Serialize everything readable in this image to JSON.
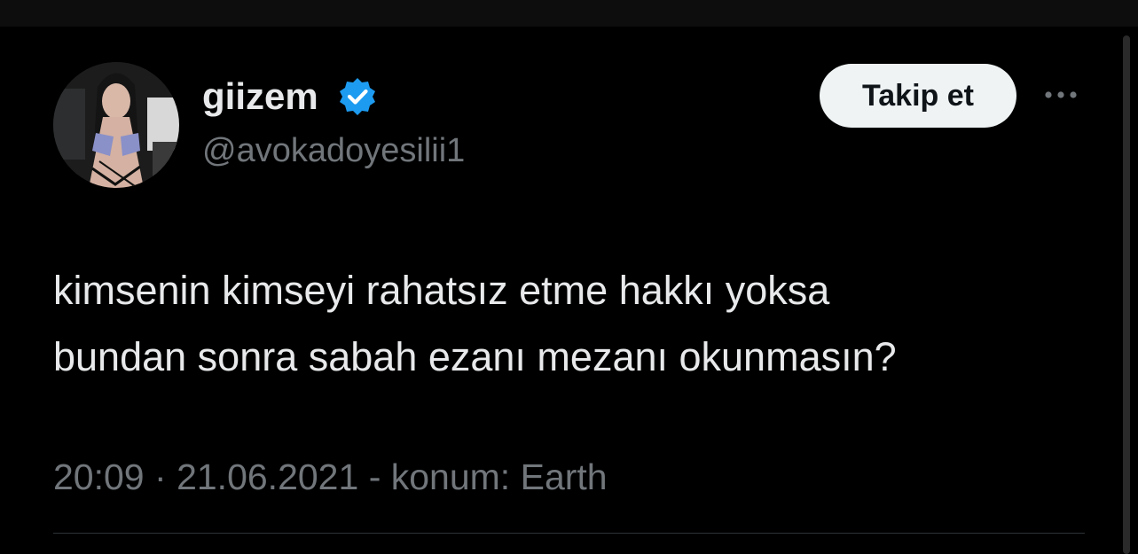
{
  "colors": {
    "background": "#000000",
    "primary_text": "#e7e9ea",
    "secondary_text": "#71767b",
    "verified_badge": "#1d9bf0",
    "follow_button_bg": "#eff3f4",
    "divider": "#2f3336"
  },
  "author": {
    "display_name": "giizem",
    "handle": "@avokadoyesilii1",
    "verified": true,
    "verified_icon": "verified-badge-icon",
    "avatar_icon": "profile-avatar"
  },
  "actions": {
    "follow_label": "Takip et",
    "more_icon": "more-options-icon"
  },
  "tweet": {
    "lines": [
      "kimsenin kimseyi rahatsız etme hakkı yoksa",
      "bundan sonra sabah ezanı mezanı okunmasın?"
    ]
  },
  "meta": {
    "time": "20:09",
    "separator": "·",
    "date": "21.06.2021",
    "location_sep": "-",
    "location_label": "konum:",
    "location": "Earth"
  }
}
